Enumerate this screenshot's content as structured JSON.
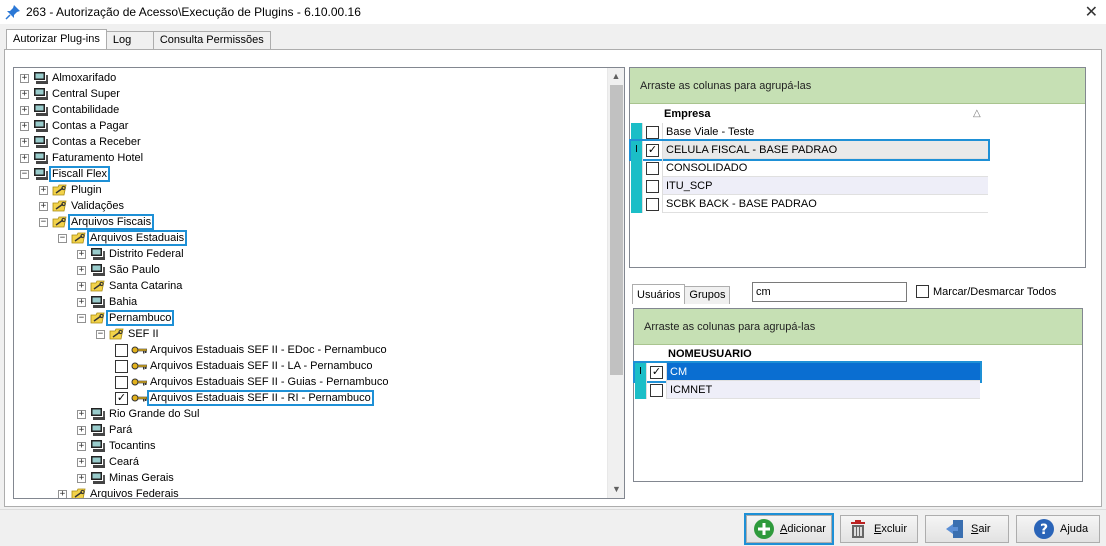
{
  "window": {
    "title": "263 - Autorização de Acesso\\Execução de Plugins - 6.10.00.16",
    "close_glyph": "✕"
  },
  "tabs": [
    "Autorizar Plug-ins",
    "Log",
    "Consulta Permissões"
  ],
  "tree": {
    "items": [
      {
        "label": "Almoxarifado",
        "icon": "computer-icon",
        "expander": "+"
      },
      {
        "label": "Central Super",
        "icon": "computer-icon",
        "expander": "+"
      },
      {
        "label": "Contabilidade",
        "icon": "computer-icon",
        "expander": "+"
      },
      {
        "label": "Contas a Pagar",
        "icon": "computer-icon",
        "expander": "+"
      },
      {
        "label": "Contas a Receber",
        "icon": "computer-icon",
        "expander": "+"
      },
      {
        "label": "Faturamento Hotel",
        "icon": "computer-icon",
        "expander": "+"
      },
      {
        "label": "Fiscall Flex",
        "icon": "computer-icon",
        "expander": "−"
      },
      {
        "label": "Plugin",
        "icon": "folder-key-icon",
        "expander": "+"
      },
      {
        "label": "Validações",
        "icon": "folder-key-icon",
        "expander": "+"
      },
      {
        "label": "Arquivos Fiscais",
        "icon": "folder-key-icon",
        "expander": "−"
      },
      {
        "label": "Arquivos Estaduais",
        "icon": "folder-key-icon",
        "expander": "−"
      },
      {
        "label": "Distrito Federal",
        "icon": "computer-icon",
        "expander": "+"
      },
      {
        "label": "São Paulo",
        "icon": "computer-icon",
        "expander": "+"
      },
      {
        "label": "Santa Catarina",
        "icon": "folder-key-icon",
        "expander": "+"
      },
      {
        "label": "Bahia",
        "icon": "computer-icon",
        "expander": "+"
      },
      {
        "label": "Pernambuco",
        "icon": "folder-key-icon",
        "expander": "−"
      },
      {
        "label": "SEF II",
        "icon": "folder-key-icon",
        "expander": "−"
      },
      {
        "label": "Arquivos Estaduais SEF II - EDoc - Pernambuco",
        "icon": "key-icon",
        "checked": false
      },
      {
        "label": "Arquivos Estaduais SEF II - LA - Pernambuco",
        "icon": "key-icon",
        "checked": false
      },
      {
        "label": "Arquivos Estaduais SEF II - Guias - Pernambuco",
        "icon": "key-icon",
        "checked": false
      },
      {
        "label": "Arquivos Estaduais SEF II - RI - Pernambuco",
        "icon": "key-icon",
        "checked": true
      },
      {
        "label": "Rio Grande do Sul",
        "icon": "computer-icon",
        "expander": "+"
      },
      {
        "label": "Pará",
        "icon": "computer-icon",
        "expander": "+"
      },
      {
        "label": "Tocantins",
        "icon": "computer-icon",
        "expander": "+"
      },
      {
        "label": "Ceará",
        "icon": "computer-icon",
        "expander": "+"
      },
      {
        "label": "Minas Gerais",
        "icon": "computer-icon",
        "expander": "+"
      },
      {
        "label": "Arquivos Federais",
        "icon": "folder-key-icon",
        "expander": "+"
      }
    ]
  },
  "empresas": {
    "group_hint": "Arraste as colunas para agrupá-las",
    "column": "Empresa",
    "sort_glyph": "△",
    "rows": [
      {
        "name": "Base Viale - Teste",
        "checked": false
      },
      {
        "name": "CELULA FISCAL - BASE PADRAO",
        "checked": true
      },
      {
        "name": "CONSOLIDADO",
        "checked": false
      },
      {
        "name": "ITU_SCP",
        "checked": false
      },
      {
        "name": "SCBK BACK - BASE PADRAO",
        "checked": false
      }
    ]
  },
  "subtabs": [
    "Usuários",
    "Grupos"
  ],
  "user_search": {
    "value": "cm"
  },
  "mark_all": {
    "label": "Marcar/Desmarcar Todos",
    "checked": false
  },
  "usuarios": {
    "group_hint": "Arraste as colunas para agrupá-las",
    "column": "NOMEUSUARIO",
    "rows": [
      {
        "name": "CM",
        "checked": true
      },
      {
        "name": "ICMNET",
        "checked": false
      }
    ]
  },
  "buttons": {
    "adicionar": {
      "pre": "",
      "ul": "A",
      "post": "dicionar"
    },
    "excluir": {
      "pre": "",
      "ul": "E",
      "post": "xcluir"
    },
    "sair": {
      "pre": "",
      "ul": "S",
      "post": "air"
    },
    "ajuda": {
      "pre": "A",
      "ul": "j",
      "post": "uda"
    }
  },
  "colors": {
    "accent": "#1bbec7",
    "highlight": "#1e90d6",
    "group_header": "#c6e0b4"
  }
}
